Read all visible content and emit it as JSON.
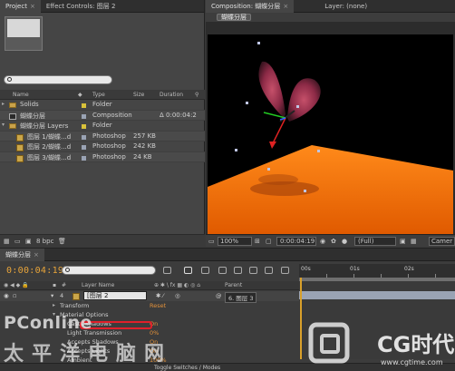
{
  "project_panel": {
    "tabs": [
      "Project",
      "Effect Controls: 图层 2"
    ],
    "columns": [
      "Name",
      "Type",
      "Size",
      "Duration"
    ],
    "items": [
      {
        "name": "Solids",
        "type": "Folder",
        "size": "",
        "duration": "",
        "icon": "folder-icon",
        "swatch": "#d9c23a",
        "indent": 0,
        "expand": "▸"
      },
      {
        "name": "蝴蝶分层",
        "type": "Composition",
        "size": "",
        "duration": "Δ 0:00:04:2",
        "icon": "composition-icon",
        "swatch": "#9aa3b4",
        "indent": 0,
        "expand": ""
      },
      {
        "name": "蝴蝶分层 Layers",
        "type": "Folder",
        "size": "",
        "duration": "",
        "icon": "folder-icon",
        "swatch": "#d9c23a",
        "indent": 0,
        "expand": "▾"
      },
      {
        "name": "图层 1/蝴蝶...d",
        "type": "Photoshop",
        "size": "257 KB",
        "duration": "",
        "icon": "photoshop-icon",
        "swatch": "#9aa3b4",
        "indent": 1,
        "expand": ""
      },
      {
        "name": "图层 2/蝴蝶...d",
        "type": "Photoshop",
        "size": "242 KB",
        "duration": "",
        "icon": "photoshop-icon",
        "swatch": "#9aa3b4",
        "indent": 1,
        "expand": ""
      },
      {
        "name": "图层 3/蝴蝶...d",
        "type": "Photoshop",
        "size": "24 KB",
        "duration": "",
        "icon": "photoshop-icon",
        "swatch": "#9aa3b4",
        "indent": 1,
        "expand": ""
      }
    ],
    "footer_bpc": "8 bpc"
  },
  "composition_panel": {
    "tabs": [
      "Composition: 蝴蝶分层",
      "Layer: (none)"
    ],
    "comp_chip": "蝴蝶分层",
    "zoom": "100%",
    "timecode": "0:00:04:19",
    "resolution": "(Full)",
    "camera": "Camer"
  },
  "timeline": {
    "tab": "蝴蝶分层",
    "timecode": "0:00:04:19",
    "ruler_labels": [
      "00s",
      "01s",
      "02s"
    ],
    "columns": {
      "layer_name": "Layer Name",
      "parent": "Parent"
    },
    "layer": {
      "index": "4",
      "name": "[图层 2",
      "parent": "6. 图层 3"
    },
    "properties": [
      {
        "label": "Transform",
        "value": "Reset",
        "indent": 1,
        "expand": "▸"
      },
      {
        "label": "Material Options",
        "value": "",
        "indent": 1,
        "expand": "▾"
      },
      {
        "label": "Casts Shadows",
        "value": "On",
        "indent": 2,
        "expand": ""
      },
      {
        "label": "Light Transmission",
        "value": "0%",
        "indent": 2,
        "expand": ""
      },
      {
        "label": "Accepts Shadows",
        "value": "On",
        "indent": 2,
        "expand": ""
      },
      {
        "label": "Accepts Lights",
        "value": "On",
        "indent": 2,
        "expand": ""
      },
      {
        "label": "Ambient",
        "value": "100%",
        "indent": 2,
        "expand": ""
      }
    ],
    "footer": "Toggle Switches / Modes"
  },
  "watermarks": {
    "pconline": "PConline",
    "pconline_cn": "太平洋电脑网",
    "cg_brand": "CG时代",
    "cg_url": "www.cgtime.com"
  },
  "colors": {
    "timecode": "#e9a53a",
    "accent_orange": "#e0903a",
    "highlight_red": "#e0202a"
  }
}
